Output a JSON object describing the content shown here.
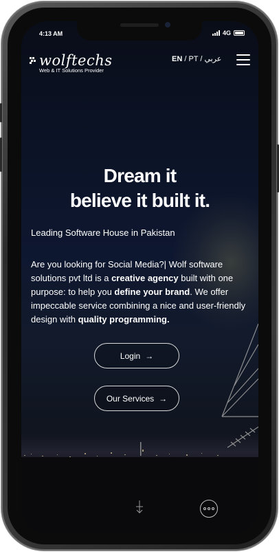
{
  "status_bar": {
    "time": "4:13 AM",
    "network": "4G"
  },
  "brand": {
    "name": "wolftechs",
    "tagline": "Web & IT Solutions Provider"
  },
  "languages": {
    "en": "EN",
    "sep1": " / ",
    "pt": "PT",
    "sep2": " / ",
    "ar": "عربي"
  },
  "hero": {
    "title_line1": "Dream it",
    "title_line2": "believe it built it.",
    "subtitle": "Leading Software House in Pakistan",
    "para_1": "Are you looking for Social Media?| Wolf software solutions pvt ltd is a ",
    "para_bold_1": "creative agency",
    "para_2": " built with one purpose: to help you ",
    "para_bold_2": "define your brand",
    "para_3": ". We offer impeccable service combining a nice and user-friendly design with ",
    "para_bold_3": "quality programming."
  },
  "buttons": {
    "login": "Login",
    "services": "Our Services",
    "arrow": "→"
  },
  "icons": [
    "wolf-logo-icon",
    "menu-icon",
    "arrow-right-icon",
    "scroll-down-icon",
    "chat-icon",
    "signal-icon",
    "battery-icon"
  ],
  "colors": {
    "text": "#ffffff",
    "background": "#0b1224",
    "button_border": "#d9d9d9"
  }
}
